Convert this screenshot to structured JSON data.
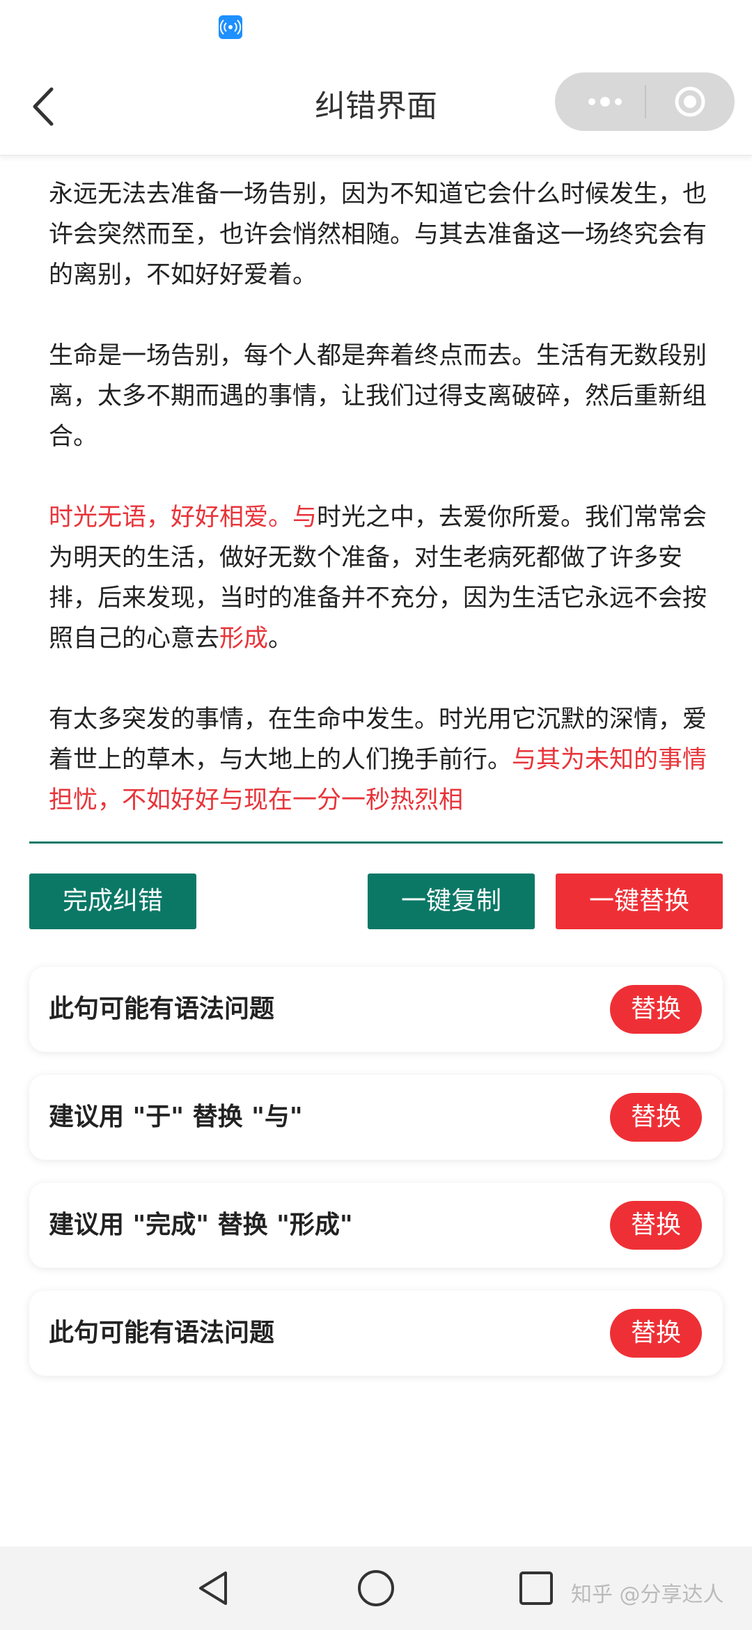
{
  "nav": {
    "title": "纠错界面"
  },
  "text": {
    "p1": "永远无法去准备一场告别，因为不知道它会什么时候发生，也许会突然而至，也许会悄然相随。与其去准备这一场终究会有的离别，不如好好爱着。",
    "p2": "生命是一场告别，每个人都是奔着终点而去。生活有无数段别离，太多不期而遇的事情，让我们过得支离破碎，然后重新组合。",
    "p3_red1": "时光无语，好好相爱。与",
    "p3_mid": "时光之中，去爱你所爱。我们常常会为明天的生活，做好无数个准备，对生老病死都做了许多安排，后来发现，当时的准备并不充分，因为生活它永远不会按照自己的心意去",
    "p3_red2": "形成",
    "p3_end": "。",
    "p4_normal": "有太多突发的事情，在生命中发生。时光用它沉默的深情，爱着世上的草木，与大地上的人们挽手前行。",
    "p4_red": "与其为未知的事情担忧，不如好好与现在一分一秒热烈相"
  },
  "actions": {
    "finish": "完成纠错",
    "copy": "一键复制",
    "replace_all": "一键替换"
  },
  "suggestions": [
    {
      "text": "此句可能有语法问题",
      "button": "替换"
    },
    {
      "text": "建议用 \"于\" 替换 \"与\"",
      "button": "替换"
    },
    {
      "text": "建议用 \"完成\" 替换 \"形成\"",
      "button": "替换"
    },
    {
      "text": "此句可能有语法问题",
      "button": "替换"
    }
  ],
  "watermark": "知乎 @分享达人",
  "colors": {
    "accent_green": "#0b7866",
    "accent_red": "#ee3036",
    "highlight_red": "#e8343a"
  }
}
